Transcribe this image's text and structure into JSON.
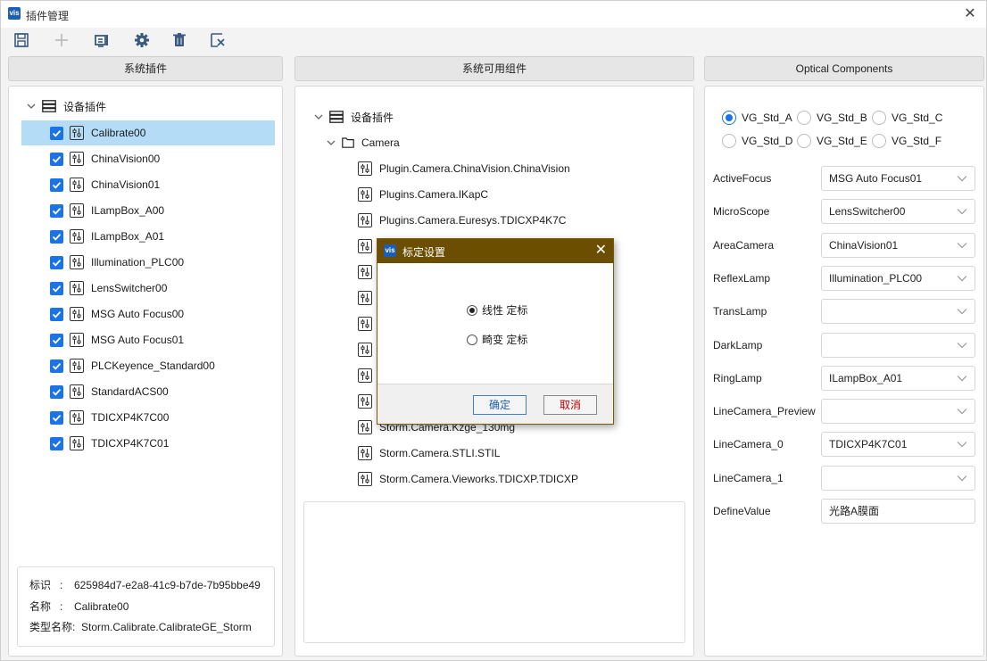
{
  "window": {
    "title": "插件管理",
    "logo": "vis"
  },
  "toolbar": {
    "icons": [
      "save-icon",
      "add-icon",
      "device-icon",
      "gear-icon",
      "trash-icon",
      "clear-icon"
    ]
  },
  "left_panel": {
    "header": "系统插件",
    "root_label": "设备插件",
    "items": [
      {
        "label": "Calibrate00",
        "checked": true,
        "selected": true
      },
      {
        "label": "ChinaVision00",
        "checked": true
      },
      {
        "label": "ChinaVision01",
        "checked": true
      },
      {
        "label": "ILampBox_A00",
        "checked": true
      },
      {
        "label": "ILampBox_A01",
        "checked": true
      },
      {
        "label": "Illumination_PLC00",
        "checked": true
      },
      {
        "label": "LensSwitcher00",
        "checked": true
      },
      {
        "label": "MSG Auto Focus00",
        "checked": true
      },
      {
        "label": "MSG Auto Focus01",
        "checked": true
      },
      {
        "label": "PLCKeyence_Standard00",
        "checked": true
      },
      {
        "label": "StandardACS00",
        "checked": true
      },
      {
        "label": "TDICXP4K7C00",
        "checked": true
      },
      {
        "label": "TDICXP4K7C01",
        "checked": true
      }
    ],
    "info": {
      "id_label": "标识",
      "id_sep": ":",
      "id_value": "625984d7-e2a8-41c9-b7de-7b95bbe49",
      "name_label": "名称",
      "name_sep": ":",
      "name_value": "Calibrate00",
      "type_label": "类型名称:",
      "type_value": "Storm.Calibrate.CalibrateGE_Storm"
    }
  },
  "middle_panel": {
    "header": "系统可用组件",
    "root_label": "设备插件",
    "folder_label": "Camera",
    "items": [
      "Plugin.Camera.ChinaVision.ChinaVision",
      "Plugins.Camera.IKapC",
      "Plugins.Camera.Euresys.TDICXP4K7C",
      "",
      "",
      "",
      "",
      "",
      "",
      "",
      "Storm.Camera.Kzge_130mg",
      "Storm.Camera.STLI.STIL",
      "Storm.Camera.Vieworks.TDICXP.TDICXP"
    ]
  },
  "right_panel": {
    "header": "Optical Components",
    "radios": [
      {
        "label": "VG_Std_A",
        "on": true
      },
      {
        "label": "VG_Std_B",
        "on": false
      },
      {
        "label": "VG_Std_C",
        "on": false
      },
      {
        "label": "VG_Std_D",
        "on": false
      },
      {
        "label": "VG_Std_E",
        "on": false
      },
      {
        "label": "VG_Std_F",
        "on": false
      }
    ],
    "props": [
      {
        "label": "ActiveFocus",
        "value": "MSG Auto Focus01"
      },
      {
        "label": "MicroScope",
        "value": "LensSwitcher00"
      },
      {
        "label": "AreaCamera",
        "value": "ChinaVision01"
      },
      {
        "label": "ReflexLamp",
        "value": "Illumination_PLC00"
      },
      {
        "label": "TransLamp",
        "value": ""
      },
      {
        "label": "DarkLamp",
        "value": ""
      },
      {
        "label": "RingLamp",
        "value": "ILampBox_A01"
      },
      {
        "label": "LineCamera_Preview",
        "value": ""
      },
      {
        "label": "LineCamera_0",
        "value": "TDICXP4K7C01"
      },
      {
        "label": "LineCamera_1",
        "value": ""
      }
    ],
    "define_label": "DefineValue",
    "define_value": "光路A膜面"
  },
  "dialog": {
    "title": "标定设置",
    "logo": "vis",
    "option1": "线性 定标",
    "option2": "畸变 定标",
    "ok": "确定",
    "cancel": "取消"
  }
}
